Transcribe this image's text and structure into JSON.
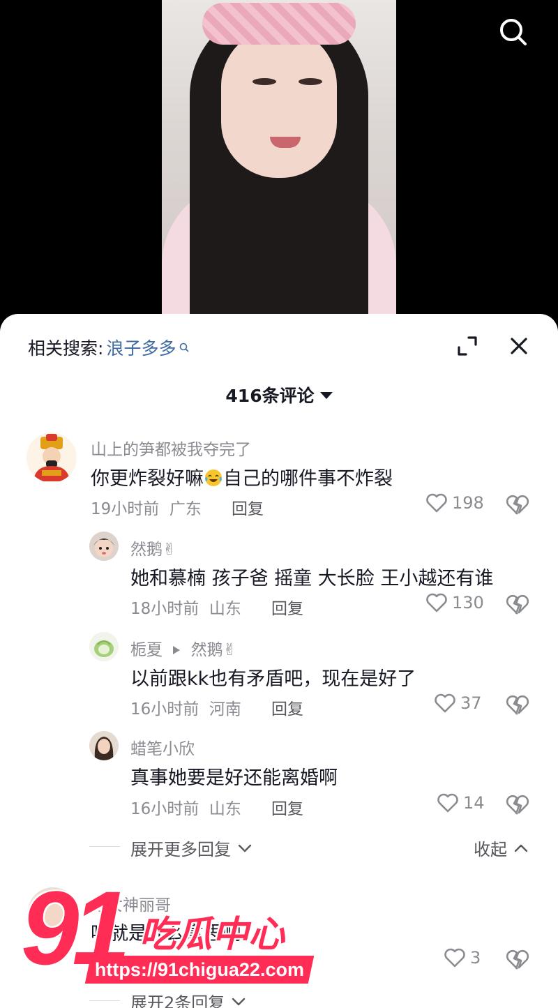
{
  "search_icon": "search-icon",
  "sheet": {
    "related_label": "相关搜索:",
    "related_keyword": "浪子多多",
    "comment_count": "416条评论"
  },
  "comments": [
    {
      "user": "山上的笋都被我夺完了",
      "text_before": "你更炸裂好嘛",
      "emoji": "laughing-tears",
      "text_after": "自己的哪件事不炸裂",
      "time": "19小时前",
      "location": "广东",
      "reply": "回复",
      "likes": "198"
    },
    {
      "user": "然鹅✌",
      "text": "她和慕楠 孩子爸 摇童 大长脸 王小越还有谁",
      "time": "18小时前",
      "location": "山东",
      "reply": "回复",
      "likes": "130"
    },
    {
      "user": "栀夏",
      "reply_to": "然鹅✌",
      "text": "以前跟kk也有矛盾吧，现在是好了",
      "time": "16小时前",
      "location": "河南",
      "reply": "回复",
      "likes": "37"
    },
    {
      "user": "蜡笔小欣",
      "text": "真事她要是好还能离婚啊",
      "time": "16小时前",
      "location": "山东",
      "reply": "回复",
      "likes": "14"
    },
    {
      "user": "万女神丽哥",
      "text": "哈就是什么意思啊，",
      "likes": "3"
    }
  ],
  "expand_more": "展开更多回复",
  "collapse": "收起",
  "expand_two": "展开2条回复",
  "watermark": {
    "number": "91",
    "name": "吃瓜中心",
    "url": "https://91chigua22.com"
  },
  "colors": {
    "accent_link": "#3d6aa0",
    "muted": "#8a8b91",
    "watermark": "#ff2d55"
  }
}
